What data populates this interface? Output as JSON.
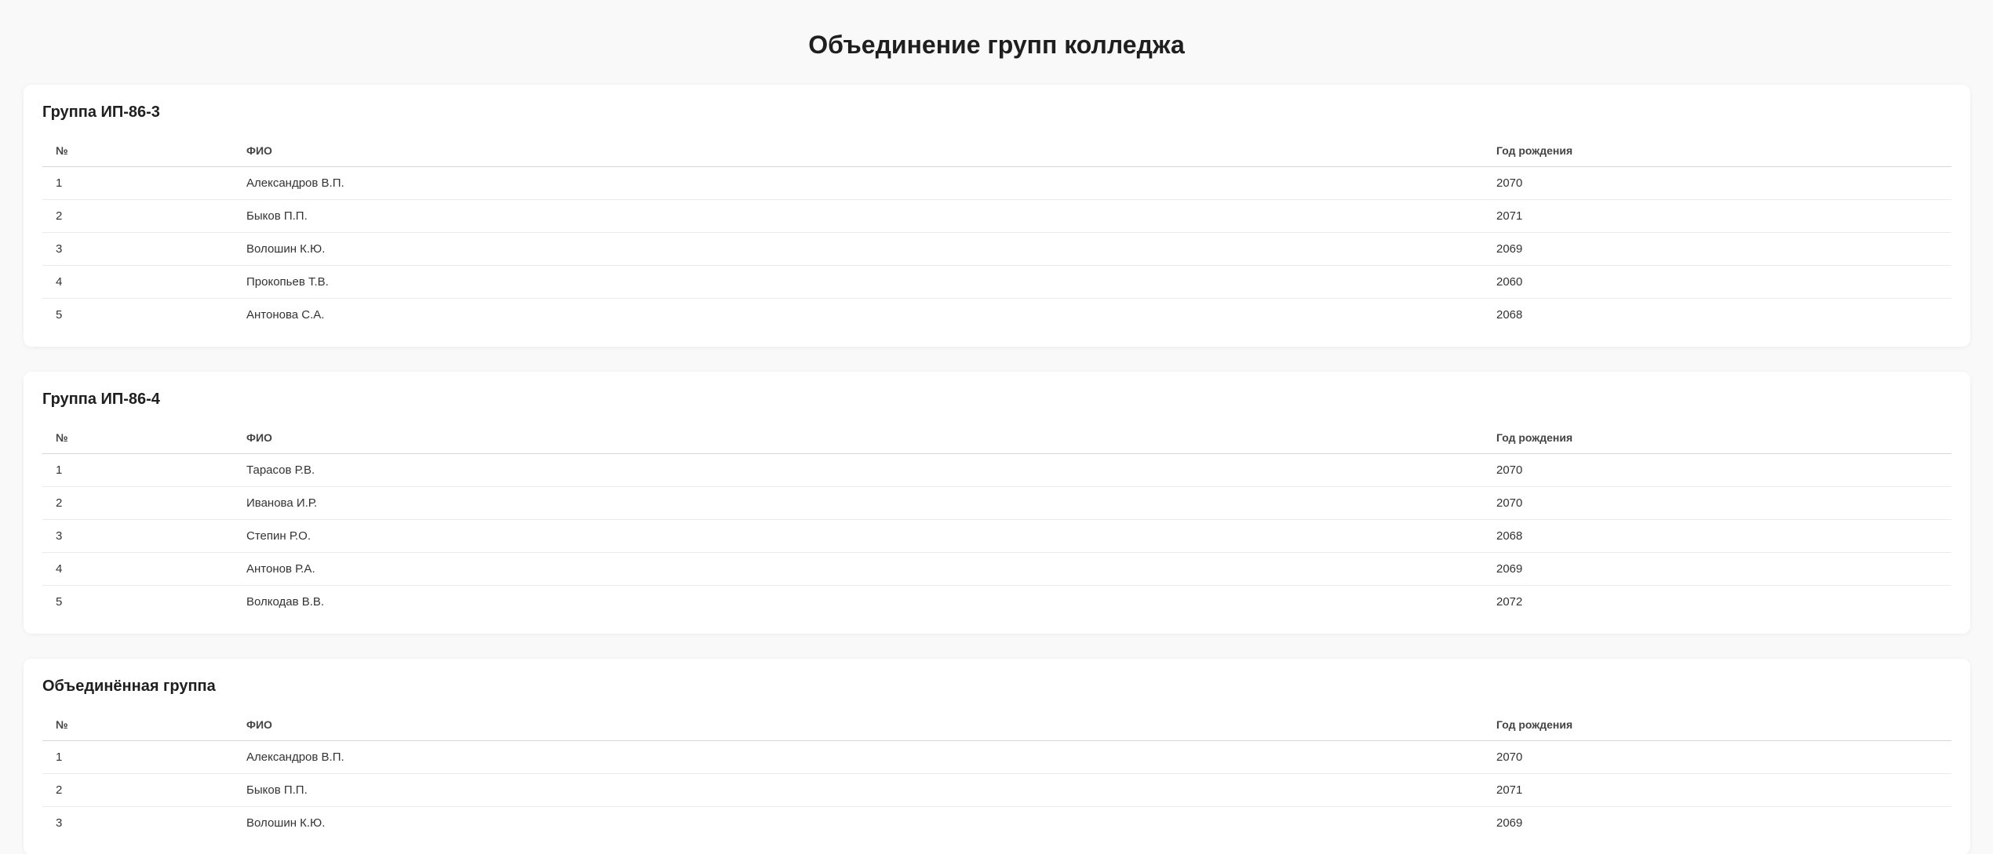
{
  "page_title": "Объединение групп колледжа",
  "columns": {
    "num": "№",
    "name": "ФИО",
    "year": "Год рождения"
  },
  "groups": [
    {
      "title": "Группа ИП-86-3",
      "rows": [
        {
          "num": "1",
          "name": "Александров В.П.",
          "year": "2070"
        },
        {
          "num": "2",
          "name": "Быков П.П.",
          "year": "2071"
        },
        {
          "num": "3",
          "name": "Волошин К.Ю.",
          "year": "2069"
        },
        {
          "num": "4",
          "name": "Прокопьев Т.В.",
          "year": "2060"
        },
        {
          "num": "5",
          "name": "Антонова С.А.",
          "year": "2068"
        }
      ]
    },
    {
      "title": "Группа ИП-86-4",
      "rows": [
        {
          "num": "1",
          "name": "Тарасов Р.В.",
          "year": "2070"
        },
        {
          "num": "2",
          "name": "Иванова И.Р.",
          "year": "2070"
        },
        {
          "num": "3",
          "name": "Степин Р.О.",
          "year": "2068"
        },
        {
          "num": "4",
          "name": "Антонов Р.А.",
          "year": "2069"
        },
        {
          "num": "5",
          "name": "Волкодав В.В.",
          "year": "2072"
        }
      ]
    },
    {
      "title": "Объединённая группа",
      "rows": [
        {
          "num": "1",
          "name": "Александров В.П.",
          "year": "2070"
        },
        {
          "num": "2",
          "name": "Быков П.П.",
          "year": "2071"
        },
        {
          "num": "3",
          "name": "Волошин К.Ю.",
          "year": "2069"
        }
      ]
    }
  ]
}
